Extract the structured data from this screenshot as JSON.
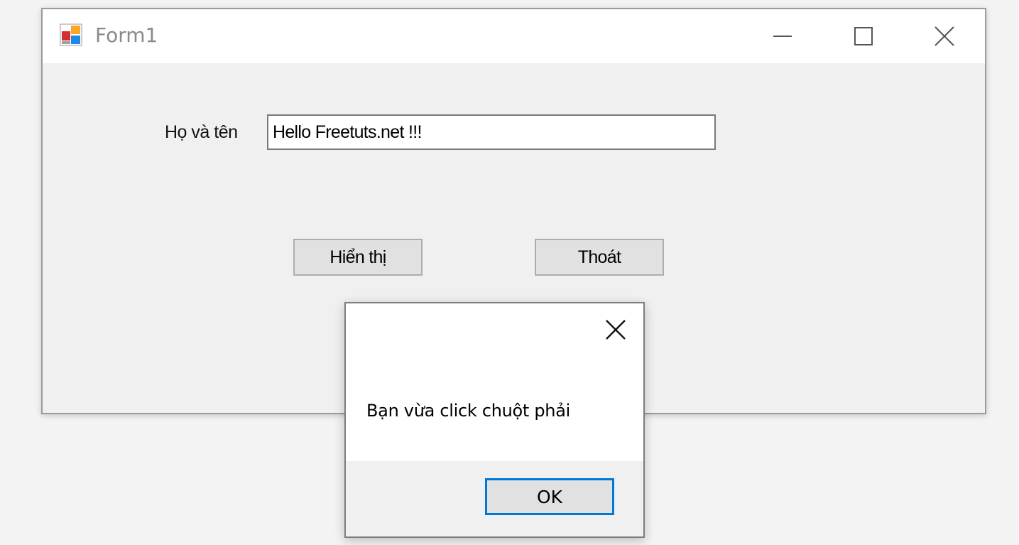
{
  "window": {
    "title": "Form1",
    "icon": "winforms-app-icon",
    "controls": {
      "minimize": "minimize-icon",
      "maximize": "maximize-icon",
      "close": "close-icon"
    }
  },
  "form": {
    "name_label": "Họ và tên",
    "name_value": "Hello Freetuts.net !!!",
    "show_button": "Hiển thị",
    "exit_button": "Thoát"
  },
  "message_box": {
    "text": "Bạn vừa click chuột phải",
    "ok_button": "OK",
    "close": "close-icon"
  },
  "colors": {
    "window_bg": "#f0f0f0",
    "titlebar_bg": "#ffffff",
    "button_bg": "#e1e1e1",
    "accent_focus": "#0078d7"
  }
}
